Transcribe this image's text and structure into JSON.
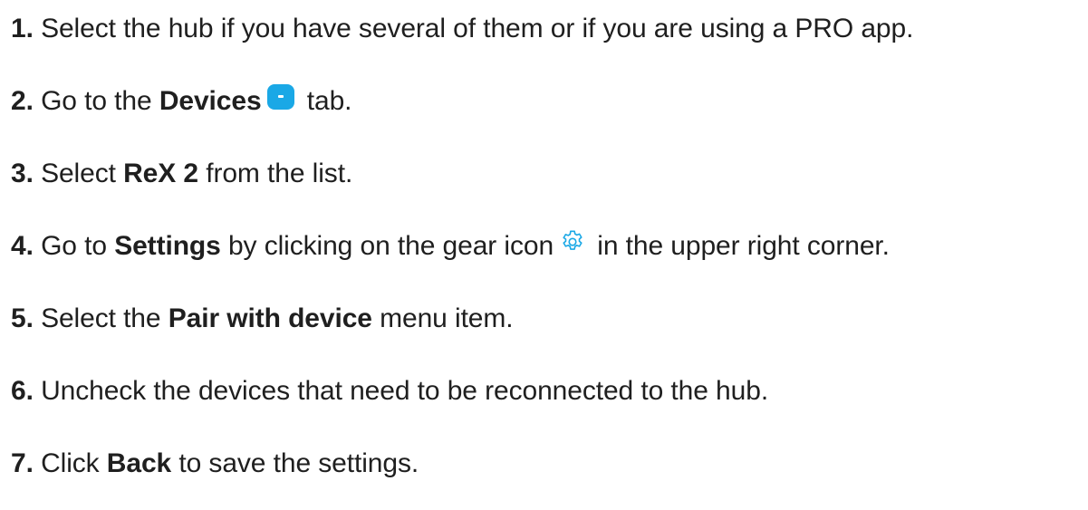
{
  "steps": [
    {
      "number": "1.",
      "text_a": " Select the hub if you have several of them or if you are using a PRO app."
    },
    {
      "number": "2.",
      "text_a": " Go to the ",
      "bold": "Devices",
      "icon": "devices-tab-icon",
      "text_b": " tab."
    },
    {
      "number": "3.",
      "text_a": " Select ",
      "bold": "ReX 2",
      "text_b": " from the list."
    },
    {
      "number": "4.",
      "text_a": " Go to ",
      "bold": "Settings",
      "text_b": " by clicking on the gear icon",
      "icon": "gear-icon",
      "text_c": " in the upper right corner."
    },
    {
      "number": "5.",
      "text_a": " Select the ",
      "bold": "Pair with device",
      "text_b": " menu item."
    },
    {
      "number": "6.",
      "text_a": " Uncheck the devices that need to be reconnected to the hub."
    },
    {
      "number": "7.",
      "text_a": " Click ",
      "bold": "Back",
      "text_b": " to save the settings."
    }
  ],
  "colors": {
    "accent": "#1aa8e6",
    "text": "#1f1f1f"
  }
}
